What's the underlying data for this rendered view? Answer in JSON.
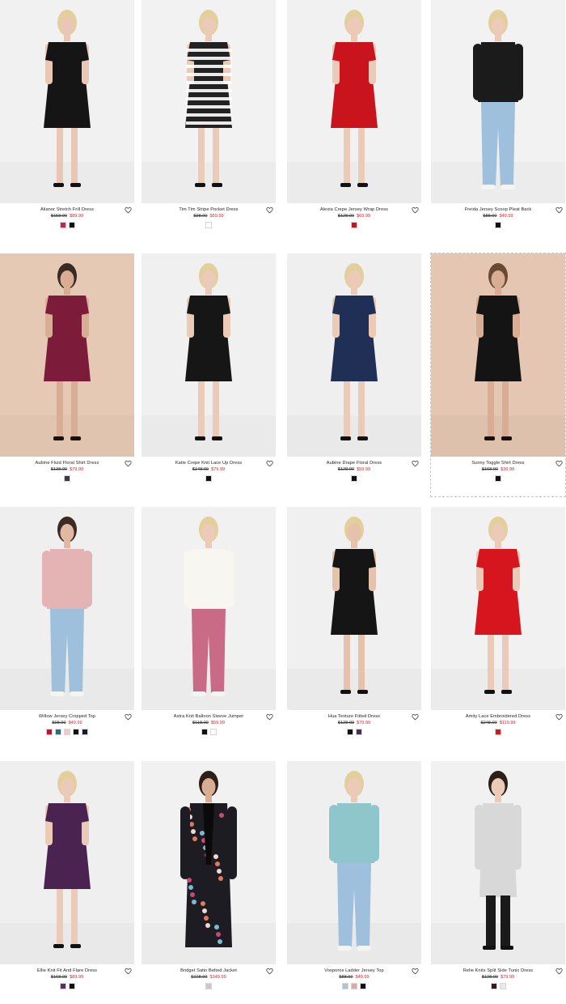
{
  "products": [
    {
      "name": "Alianor Stretch Frill Dress",
      "old_price": "$158.00",
      "new_price": "$89.99",
      "bg": "#f1f1f1",
      "garment": "#151515",
      "skin": "#e9c7b4",
      "hair": "#e2cf9b",
      "style": "dress",
      "swatches": [
        "#c8254a",
        "#111111"
      ]
    },
    {
      "name": "Tim Tim Stripe Pocket Dress",
      "old_price": "$98.00",
      "new_price": "$59.99",
      "bg": "#f2f2f2",
      "garment": "#222222",
      "skin": "#ebcab8",
      "hair": "#e2cf9b",
      "style": "stripe",
      "swatches": [
        "#ffffff"
      ]
    },
    {
      "name": "Alexia Crepe Jersey Wrap Dress",
      "old_price": "$128.00",
      "new_price": "$69.99",
      "bg": "#f1f1f1",
      "garment": "#c9141e",
      "skin": "#ebcab8",
      "hair": "#e2cf9b",
      "style": "dress",
      "swatches": [
        "#c9141e"
      ]
    },
    {
      "name": "Freida Jersey Scoop Pleat Back",
      "old_price": "$88.00",
      "new_price": "$49.99",
      "bg": "#f2f2f2",
      "garment": "#1b1b1b",
      "skin": "#ebcab8",
      "hair": "#e2cf9b",
      "style": "topjeans",
      "swatches": [
        "#111111"
      ]
    },
    {
      "name": "Aubine Fluid Floral Shirt Dress",
      "old_price": "$138.00",
      "new_price": "$79.99",
      "bg": "#e6c9b4",
      "garment": "#7d1c3a",
      "skin": "#d9ad93",
      "hair": "#3a2a22",
      "style": "dress",
      "swatches": [
        "#3d3a3f"
      ]
    },
    {
      "name": "Katie Crepe Knit Lace Up Dress",
      "old_price": "$148.00",
      "new_price": "$79.99",
      "bg": "#f0f0f0",
      "garment": "#161616",
      "skin": "#ebcab8",
      "hair": "#e2cf9b",
      "style": "dress",
      "swatches": [
        "#111111"
      ]
    },
    {
      "name": "Aubine Drape Floral Dress",
      "old_price": "$128.00",
      "new_price": "$59.99",
      "bg": "#efefef",
      "garment": "#1f2f55",
      "skin": "#ebcab8",
      "hair": "#e2cf9b",
      "style": "dress",
      "swatches": [
        "#111111"
      ]
    },
    {
      "name": "Sunny Toggle Shirt Dress",
      "old_price": "$168.00",
      "new_price": "$39.99",
      "bg": "#e4c6b2",
      "garment": "#141414",
      "skin": "#d8ad94",
      "hair": "#6b4a34",
      "style": "dress",
      "swatches": [
        "#111111"
      ]
    },
    {
      "name": "Willow Jersey Cropped Top",
      "old_price": "$98.00",
      "new_price": "$49.99",
      "bg": "#efefef",
      "garment": "#e4b3b4",
      "skin": "#e1b9a3",
      "hair": "#3a2a22",
      "style": "topjeans",
      "swatches": [
        "#c8102e",
        "#2b6f80",
        "#f1c9c9",
        "#111111",
        "#1a1a2e"
      ]
    },
    {
      "name": "Astra Knit Balloon Sleeve Jumper",
      "old_price": "$118.00",
      "new_price": "$59.99",
      "bg": "#f1f1f1",
      "garment": "#f7f6f1",
      "skin": "#ebcab8",
      "hair": "#e2cf9b",
      "style": "jumper",
      "swatches": [
        "#111111",
        "#ffffff"
      ]
    },
    {
      "name": "Hua Texture Fitted Dress",
      "old_price": "$128.00",
      "new_price": "$79.99",
      "bg": "#f0f0f0",
      "garment": "#151515",
      "skin": "#e6c2ad",
      "hair": "#e2cf9b",
      "style": "dress",
      "swatches": [
        "#111111",
        "#4a2d5c"
      ]
    },
    {
      "name": "Amity Lace Embroidered Dress",
      "old_price": "$248.00",
      "new_price": "$119.99",
      "bg": "#f1f1f1",
      "garment": "#d6151f",
      "skin": "#ebcab8",
      "hair": "#e2cf9b",
      "style": "dress",
      "swatches": [
        "#d6151f"
      ]
    },
    {
      "name": "Ellie Knit Fit And Flare Dress",
      "old_price": "$168.00",
      "new_price": "$89.99",
      "bg": "#efefef",
      "garment": "#4a2350",
      "skin": "#ebcab8",
      "hair": "#e2cf9b",
      "style": "dress",
      "swatches": [
        "#5a2d6a",
        "#111111"
      ]
    },
    {
      "name": "Bridget Satin Belted Jacket",
      "old_price": "$228.00",
      "new_price": "$149.99",
      "bg": "#f1f1f1",
      "garment": "#1c1c22",
      "skin": "#d9ad93",
      "hair": "#2c1f18",
      "style": "suit",
      "swatches": [
        "#c9c9c9"
      ]
    },
    {
      "name": "Vosporos Ladder Jersey Top",
      "old_price": "$88.00",
      "new_price": "$49.99",
      "bg": "#efefef",
      "garment": "#8fc6cc",
      "skin": "#ebcab8",
      "hair": "#e2cf9b",
      "style": "topjeans",
      "swatches": [
        "#a9c6d2",
        "#d9aaa9",
        "#111111"
      ]
    },
    {
      "name": "Relie Knits Split Side Tunic Dress",
      "old_price": "$128.00",
      "new_price": "$79.99",
      "bg": "#f1f1f1",
      "garment": "#d8d8d8",
      "skin": "#ebcab8",
      "hair": "#2c1f18",
      "style": "tunic",
      "swatches": [
        "#3a1525",
        "#e9e9e9"
      ]
    }
  ]
}
